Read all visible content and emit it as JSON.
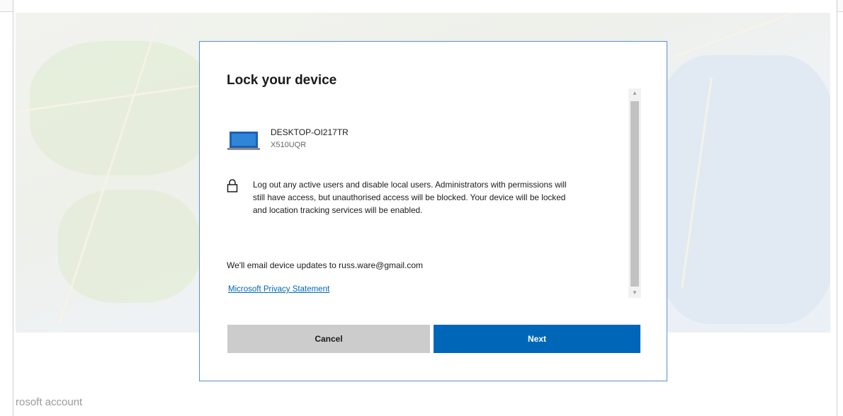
{
  "dialog": {
    "title": "Lock your device",
    "device": {
      "name": "DESKTOP-OI217TR",
      "model": "X510UQR",
      "icon": "laptop-icon"
    },
    "lock_message": "Log out any active users and disable local users. Administrators with permissions will still have access, but unauthorised access will be blocked. Your device will be locked and location tracking services will be enabled.",
    "lock_icon": "lock-icon",
    "email_notice": "We'll email device updates to russ.ware@gmail.com",
    "privacy_link": "Microsoft Privacy Statement",
    "buttons": {
      "cancel": "Cancel",
      "next": "Next"
    },
    "scrollbar": {
      "up_arrow": "▲",
      "down_arrow": "▼"
    }
  },
  "background": {
    "footer_text": "rosoft account"
  },
  "colors": {
    "accent": "#0067b8",
    "cancel_bg": "#cccccc",
    "dialog_border": "#5b8fc7"
  }
}
